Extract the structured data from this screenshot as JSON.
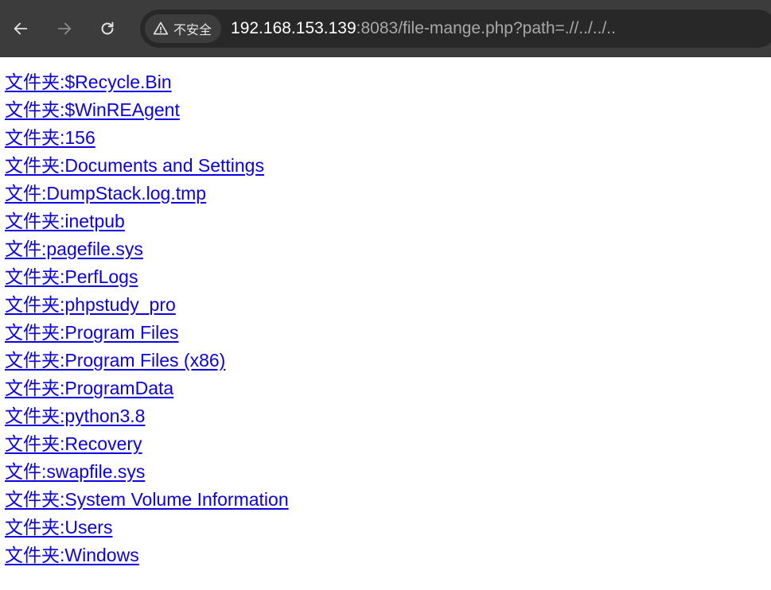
{
  "browser": {
    "security_label": "不安全",
    "url_host": "192.168.153.139",
    "url_rest": ":8083/file-mange.php?path=.//../../..",
    "back_icon": "arrow-left-icon",
    "forward_icon": "arrow-right-icon",
    "reload_icon": "reload-icon",
    "warning_icon": "warning-triangle-icon"
  },
  "listing": [
    "文件夹:$Recycle.Bin",
    "文件夹:$WinREAgent",
    "文件夹:156",
    "文件夹:Documents and Settings",
    "文件:DumpStack.log.tmp",
    "文件夹:inetpub",
    "文件:pagefile.sys",
    "文件夹:PerfLogs",
    "文件夹:phpstudy_pro",
    "文件夹:Program Files",
    "文件夹:Program Files (x86)",
    "文件夹:ProgramData",
    "文件夹:python3.8",
    "文件夹:Recovery",
    "文件:swapfile.sys",
    "文件夹:System Volume Information",
    "文件夹:Users",
    "文件夹:Windows"
  ],
  "colors": {
    "toolbar_bg": "#3c3c3c",
    "omnibox_bg": "#282828",
    "link": "#0b00e6"
  }
}
